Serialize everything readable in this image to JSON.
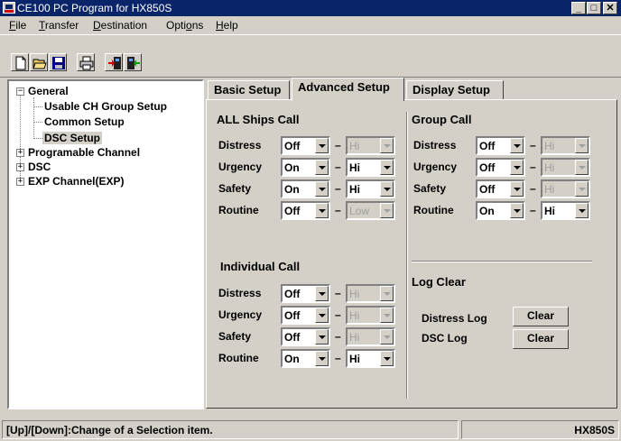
{
  "window": {
    "title": "CE100  PC Program for HX850S"
  },
  "menu": {
    "file": {
      "first": "F",
      "rest": "ile"
    },
    "transfer": {
      "first": "T",
      "rest": "ransfer"
    },
    "destination": {
      "first": "D",
      "rest": "estination"
    },
    "options": {
      "pre": "Opti",
      "key": "o",
      "post": "ns"
    },
    "help": {
      "first": "H",
      "rest": "elp"
    }
  },
  "toolbar": {
    "buttons": [
      "new-icon",
      "open-icon",
      "save-icon",
      "print-icon",
      "download-icon",
      "upload-icon"
    ]
  },
  "tree": {
    "general": "General",
    "usable_ch": "Usable CH Group Setup",
    "common": "Common Setup",
    "dsc_setup": "DSC Setup",
    "programable": "Programable Channel",
    "dsc": "DSC",
    "exp": "EXP Channel(EXP)",
    "expander_open": "−",
    "expander_closed": "+"
  },
  "tabs": {
    "basic": "Basic Setup",
    "advanced": "Advanced Setup",
    "display": "Display Setup"
  },
  "dash": "–",
  "all_ships": {
    "title": "ALL Ships Call",
    "rows": [
      {
        "label": "Distress",
        "mode": "Off",
        "level": "Hi"
      },
      {
        "label": "Urgency",
        "mode": "On",
        "level": "Hi"
      },
      {
        "label": "Safety",
        "mode": "On",
        "level": "Hi"
      },
      {
        "label": "Routine",
        "mode": "Off",
        "level": "Low"
      }
    ]
  },
  "group": {
    "title": "Group Call",
    "rows": [
      {
        "label": "Distress",
        "mode": "Off",
        "level": "Hi"
      },
      {
        "label": "Urgency",
        "mode": "Off",
        "level": "Hi"
      },
      {
        "label": "Safety",
        "mode": "Off",
        "level": "Hi"
      },
      {
        "label": "Routine",
        "mode": "On",
        "level": "Hi"
      }
    ]
  },
  "individual": {
    "title": "Individual Call",
    "rows": [
      {
        "label": "Distress",
        "mode": "Off",
        "level": "Hi"
      },
      {
        "label": "Urgency",
        "mode": "Off",
        "level": "Hi"
      },
      {
        "label": "Safety",
        "mode": "Off",
        "level": "Hi"
      },
      {
        "label": "Routine",
        "mode": "On",
        "level": "Hi"
      }
    ]
  },
  "log_clear": {
    "title": "Log Clear",
    "distress_label": "Distress Log",
    "dsc_label": "DSC Log",
    "button": "Clear"
  },
  "status": {
    "hint": "[Up]/[Down]:Change of a Selection item.",
    "model": "HX850S"
  }
}
